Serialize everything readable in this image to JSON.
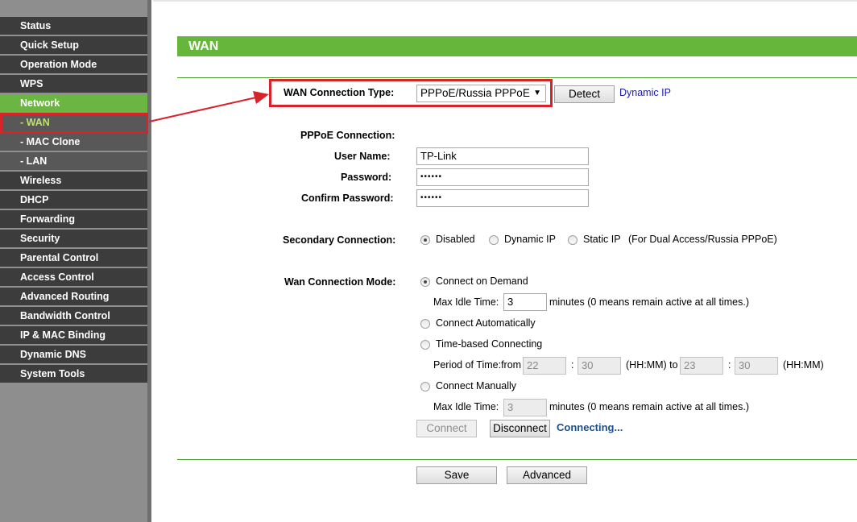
{
  "sidebar": {
    "items": [
      {
        "label": "Status",
        "type": "main"
      },
      {
        "label": "Quick Setup",
        "type": "main"
      },
      {
        "label": "Operation Mode",
        "type": "main"
      },
      {
        "label": "WPS",
        "type": "main"
      },
      {
        "label": "Network",
        "type": "main",
        "active": true
      },
      {
        "label": "- WAN",
        "type": "sub",
        "current": true
      },
      {
        "label": "- MAC Clone",
        "type": "sub"
      },
      {
        "label": "- LAN",
        "type": "sub"
      },
      {
        "label": "Wireless",
        "type": "main"
      },
      {
        "label": "DHCP",
        "type": "main"
      },
      {
        "label": "Forwarding",
        "type": "main"
      },
      {
        "label": "Security",
        "type": "main"
      },
      {
        "label": "Parental Control",
        "type": "main"
      },
      {
        "label": "Access Control",
        "type": "main"
      },
      {
        "label": "Advanced Routing",
        "type": "main"
      },
      {
        "label": "Bandwidth Control",
        "type": "main"
      },
      {
        "label": "IP & MAC Binding",
        "type": "main"
      },
      {
        "label": "Dynamic DNS",
        "type": "main"
      },
      {
        "label": "System Tools",
        "type": "main"
      }
    ]
  },
  "page": {
    "title": "WAN",
    "wan_type_label": "WAN Connection Type:",
    "wan_type_value": "PPPoE/Russia PPPoE",
    "detect_button": "Detect",
    "detected_type": "Dynamic IP",
    "pppoe_heading": "PPPoE Connection:",
    "username_label": "User Name:",
    "username_value": "TP-Link",
    "password_label": "Password:",
    "password_value": "••••••",
    "confirm_label": "Confirm Password:",
    "confirm_value": "••••••",
    "secondary": {
      "label": "Secondary Connection:",
      "options": [
        "Disabled",
        "Dynamic IP",
        "Static IP"
      ],
      "selected": "Disabled",
      "note": "(For Dual Access/Russia PPPoE)"
    },
    "mode": {
      "label": "Wan Connection Mode:",
      "connect_on_demand": "Connect on Demand",
      "max_idle_label": "Max Idle Time:",
      "max_idle_value_1": "3",
      "max_idle_suffix": "minutes (0 means remain active at all times.)",
      "connect_automatically": "Connect Automatically",
      "time_based": "Time-based Connecting",
      "period_label": "Period of Time:from",
      "from_hh": "22",
      "from_mm": "30",
      "colon": ":",
      "hhmm_to": "(HH:MM) to",
      "to_hh": "23",
      "to_mm": "30",
      "hhmm": "(HH:MM)",
      "connect_manually": "Connect Manually",
      "max_idle_value_2": "3",
      "selected": "Connect on Demand"
    },
    "connect_button": "Connect",
    "disconnect_button": "Disconnect",
    "status_text": "Connecting...",
    "save_button": "Save",
    "advanced_button": "Advanced"
  },
  "colors": {
    "accent_green": "#67b63c",
    "highlight_red": "#d9232a",
    "link_blue": "#1a1aa6",
    "status_blue": "#1f4e8c"
  }
}
